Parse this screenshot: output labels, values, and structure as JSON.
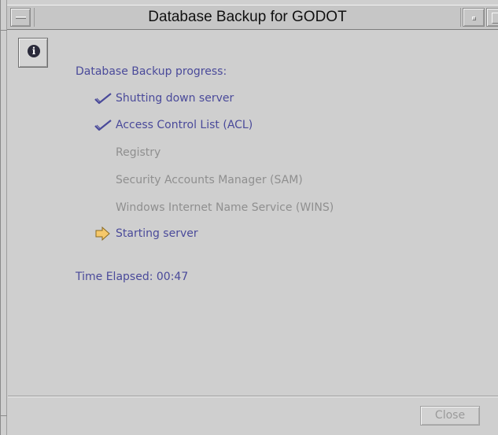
{
  "window": {
    "title": "Database Backup for GODOT"
  },
  "content": {
    "progress_title": "Database Backup progress:",
    "steps": [
      {
        "label": "Shutting down server",
        "status": "done",
        "icon": "checkmark-icon"
      },
      {
        "label": "Access Control List (ACL)",
        "status": "done",
        "icon": "checkmark-icon"
      },
      {
        "label": "Registry",
        "status": "pending",
        "icon": ""
      },
      {
        "label": "Security Accounts Manager (SAM)",
        "status": "pending",
        "icon": ""
      },
      {
        "label": "Windows Internet Name Service (WINS)",
        "status": "pending",
        "icon": ""
      },
      {
        "label": "Starting server",
        "status": "current",
        "icon": "arrow-right-icon"
      }
    ],
    "elapsed_label": "Time Elapsed:",
    "elapsed_value": "00:47"
  },
  "footer": {
    "close_label": "Close",
    "close_enabled": false
  },
  "colors": {
    "accent_text": "#4a4a9a",
    "disabled_text": "#8f8f8f",
    "arrow_fill": "#f6c86a",
    "background": "#cfcfcf"
  }
}
